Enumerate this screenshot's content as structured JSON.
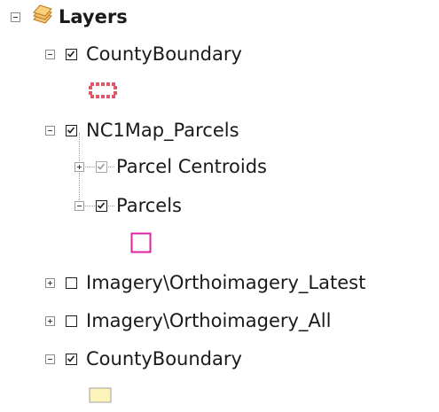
{
  "toc": {
    "root": {
      "label": "Layers",
      "expanded": true,
      "icon": "layers-stack-icon"
    },
    "items": [
      {
        "label": "CountyBoundary",
        "checked": true,
        "expanded": true,
        "symbol": "county-boundary-pink-dashed-symbol"
      },
      {
        "label": "NC1Map_Parcels",
        "checked": true,
        "expanded": true
      },
      {
        "label": "Parcel Centroids",
        "checked": true,
        "checkbox_state": "greyed",
        "expanded": false
      },
      {
        "label": "Parcels",
        "checked": true,
        "expanded": true,
        "symbol": "parcels-magenta-outline-symbol"
      },
      {
        "label": "Imagery\\Orthoimagery_Latest",
        "checked": false,
        "expanded": false
      },
      {
        "label": "Imagery\\Orthoimagery_All",
        "checked": false,
        "expanded": false
      },
      {
        "label": "CountyBoundary",
        "checked": true,
        "expanded": true,
        "symbol": "county-boundary-yellow-fill-symbol"
      }
    ],
    "colors": {
      "county_boundary_symbol": "#e0576a",
      "parcels_outline": "#e0249f",
      "county_fill": "#fbf3b8",
      "county_fill_border": "#a0a0a0",
      "layers_icon": "#e8a33a"
    }
  }
}
